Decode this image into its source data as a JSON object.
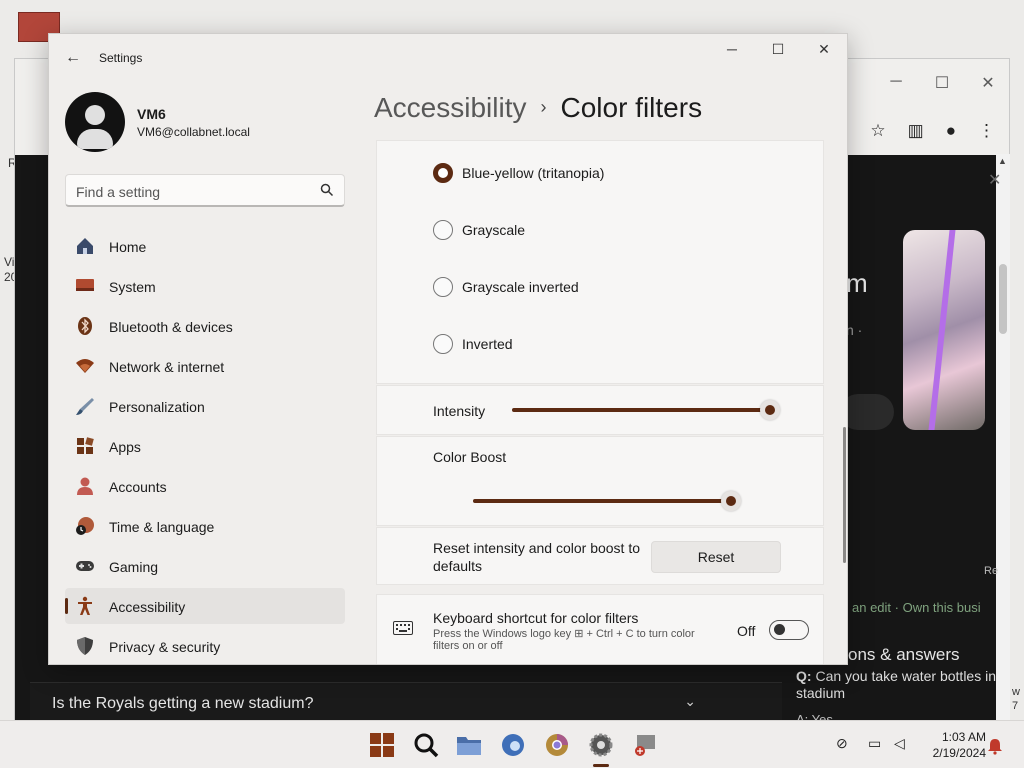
{
  "background": {
    "frag_left_1": "R",
    "frag_left_2": "Vi",
    "frag_left_3": "20",
    "frag_m": "m",
    "frag_n": "n ·",
    "frag_edit": "an edit · Own this busi",
    "faq_question": "Is the Royals getting a new stadium?",
    "qa_heading": "ons & answers",
    "qa_q_label": "Q:",
    "qa_q_text": "Can you take water bottles in stadium",
    "qa_a": "A: Yes",
    "frag_re": "Re",
    "frag_w": "w",
    "frag_7": "7"
  },
  "window": {
    "title": "Settings",
    "profile_name": "VM6",
    "profile_email": "VM6@collabnet.local",
    "search_placeholder": "Find a setting"
  },
  "nav": {
    "items": [
      {
        "label": "Home",
        "icon": "home-icon"
      },
      {
        "label": "System",
        "icon": "system-icon"
      },
      {
        "label": "Bluetooth & devices",
        "icon": "bluetooth-icon"
      },
      {
        "label": "Network & internet",
        "icon": "wifi-icon"
      },
      {
        "label": "Personalization",
        "icon": "brush-icon"
      },
      {
        "label": "Apps",
        "icon": "apps-icon"
      },
      {
        "label": "Accounts",
        "icon": "accounts-icon"
      },
      {
        "label": "Time & language",
        "icon": "clock-globe-icon"
      },
      {
        "label": "Gaming",
        "icon": "gamepad-icon"
      },
      {
        "label": "Accessibility",
        "icon": "accessibility-icon",
        "active": true
      },
      {
        "label": "Privacy & security",
        "icon": "shield-icon"
      }
    ]
  },
  "breadcrumb": {
    "parent": "Accessibility",
    "separator": "›",
    "current": "Color filters"
  },
  "filters": {
    "options": [
      {
        "label": "Blue-yellow (tritanopia)",
        "selected": true
      },
      {
        "label": "Grayscale",
        "selected": false
      },
      {
        "label": "Grayscale inverted",
        "selected": false
      },
      {
        "label": "Inverted",
        "selected": false
      }
    ],
    "intensity_label": "Intensity",
    "intensity_value": 1.0,
    "boost_label": "Color Boost",
    "boost_value": 1.0,
    "reset_label": "Reset intensity and color boost to defaults",
    "reset_button": "Reset",
    "shortcut_title": "Keyboard shortcut for color filters",
    "shortcut_desc": "Press the Windows logo key ⊞ + Ctrl + C to turn color filters on or off",
    "shortcut_state": "Off"
  },
  "taskbar": {
    "time": "1:03 AM",
    "date": "2/19/2024"
  },
  "colors": {
    "accent": "#5c2a12",
    "window_bg": "#f0eeec",
    "panel_bg": "#f7f6f5"
  }
}
